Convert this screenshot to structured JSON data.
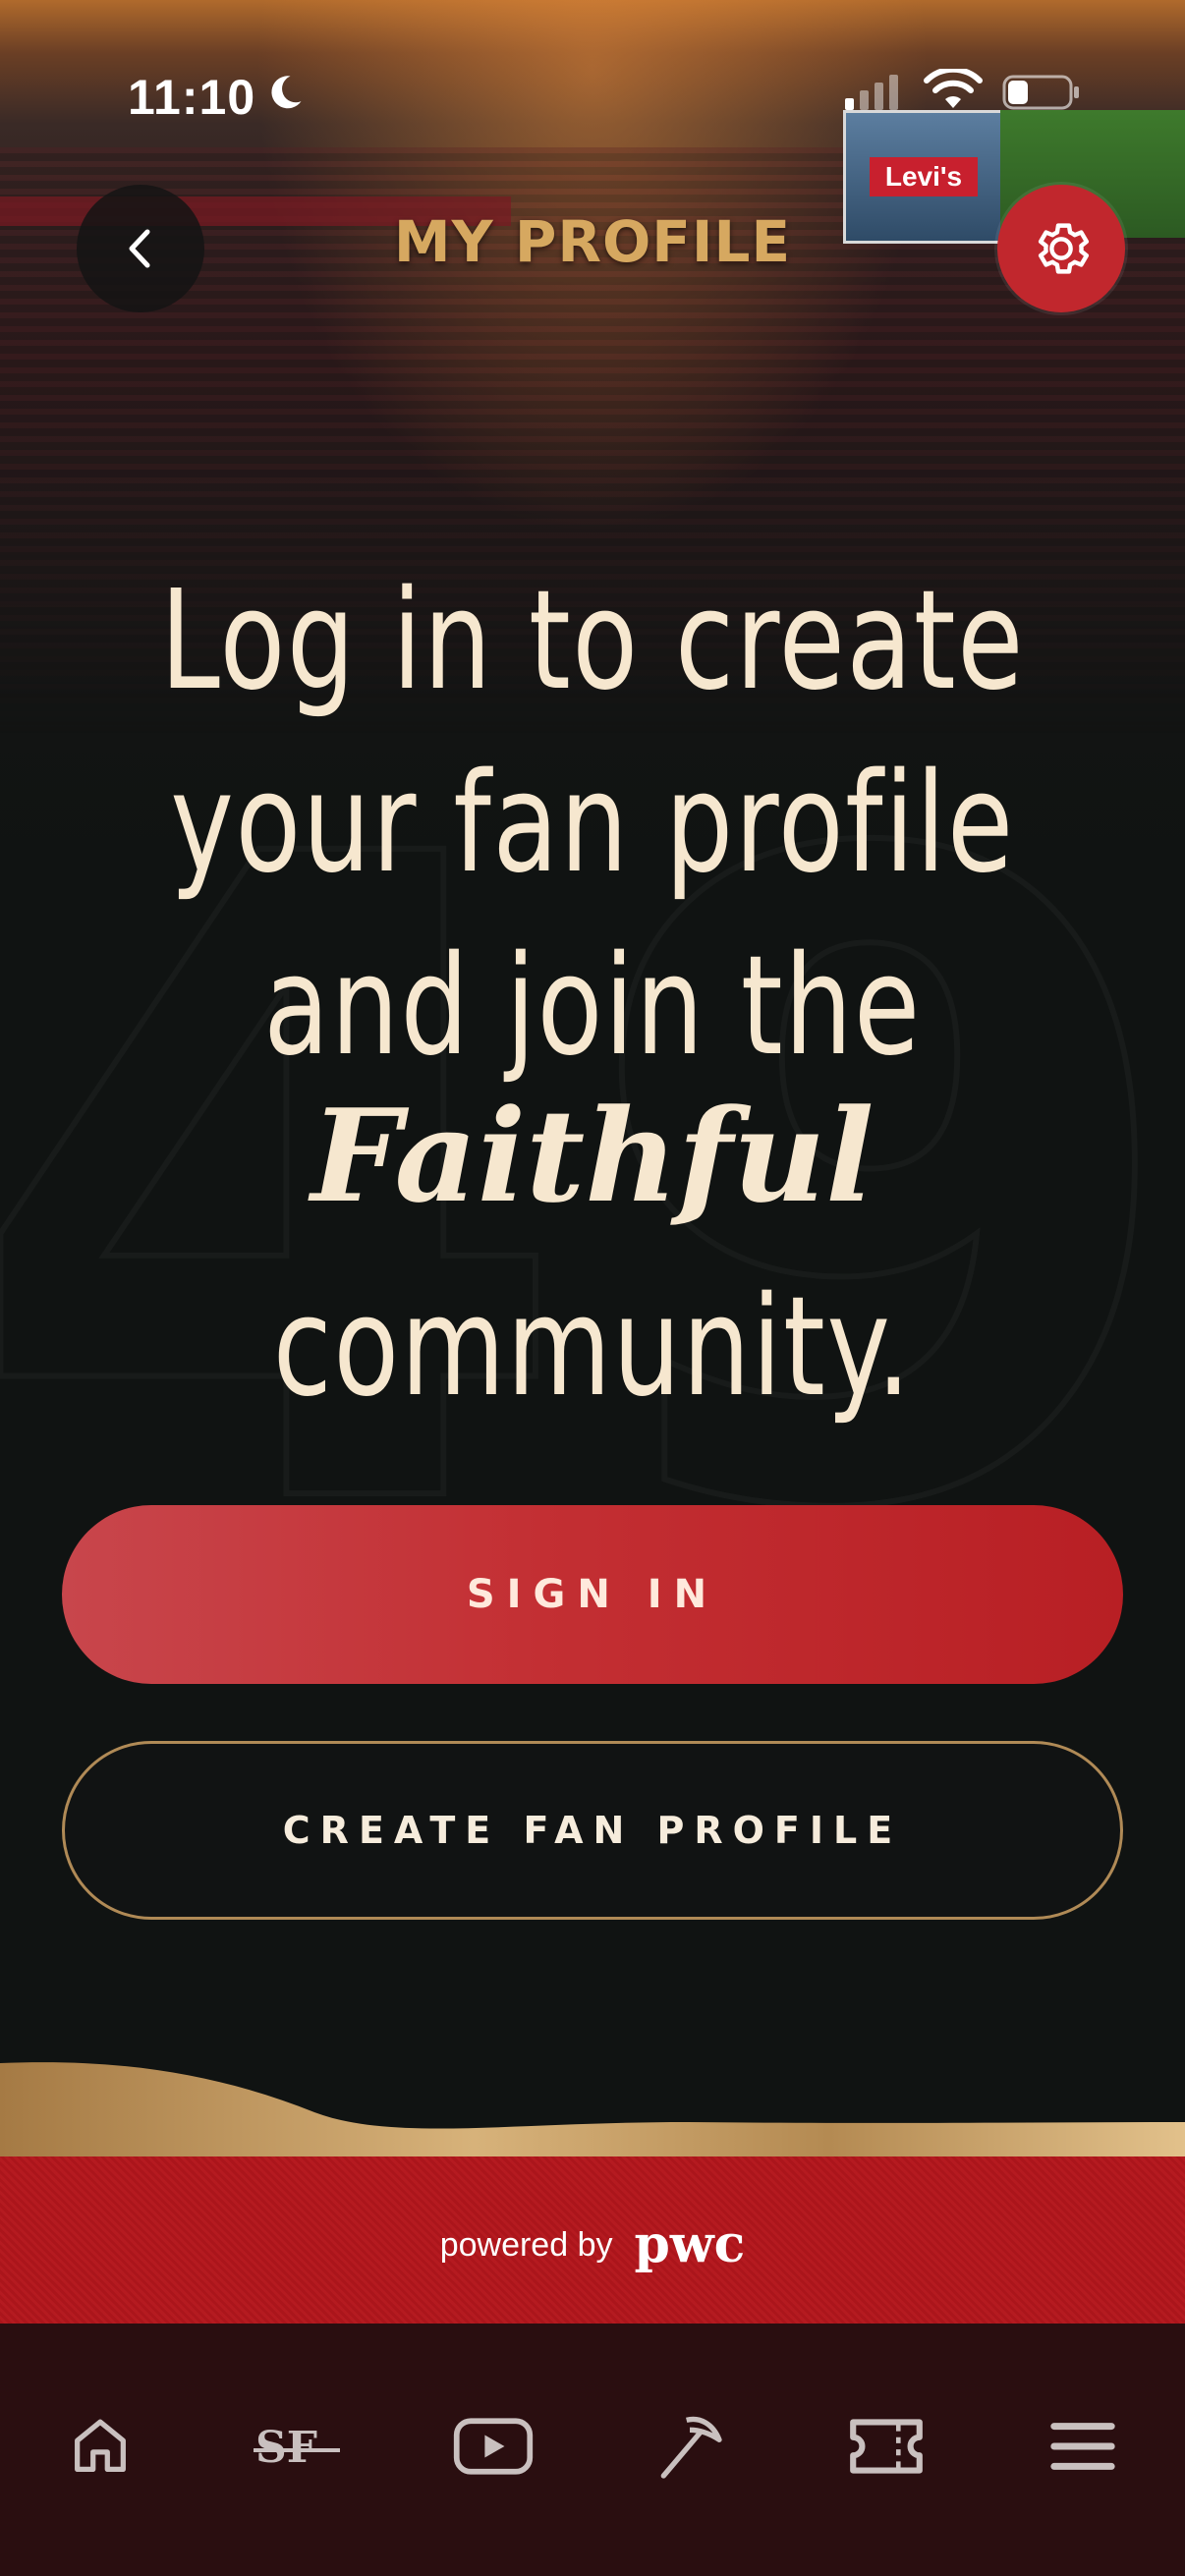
{
  "status_bar": {
    "time": "11:10"
  },
  "header": {
    "title": "MY PROFILE",
    "back_icon": "chevron-left-icon",
    "settings_icon": "gear-icon"
  },
  "background": {
    "scoreboard_brand": "Levi's"
  },
  "headline": {
    "lines": [
      "Log in to create",
      "your fan profile",
      "and join the"
    ],
    "script_word": "Faithful",
    "last_line": "community."
  },
  "buttons": {
    "sign_in": "SIGN IN",
    "create_profile": "CREATE FAN PROFILE"
  },
  "footer": {
    "powered_by": "powered by",
    "brand": "pwc"
  },
  "tabbar": {
    "items": [
      {
        "icon": "home-icon"
      },
      {
        "icon": "sf-logo-icon"
      },
      {
        "icon": "play-icon"
      },
      {
        "icon": "pickaxe-icon"
      },
      {
        "icon": "ticket-icon"
      },
      {
        "icon": "menu-icon"
      }
    ]
  },
  "colors": {
    "accent_red": "#c1272d",
    "gold": "#d6a860",
    "cream_text": "#f6e7cf",
    "tabbar_bg": "#2a0e10"
  }
}
